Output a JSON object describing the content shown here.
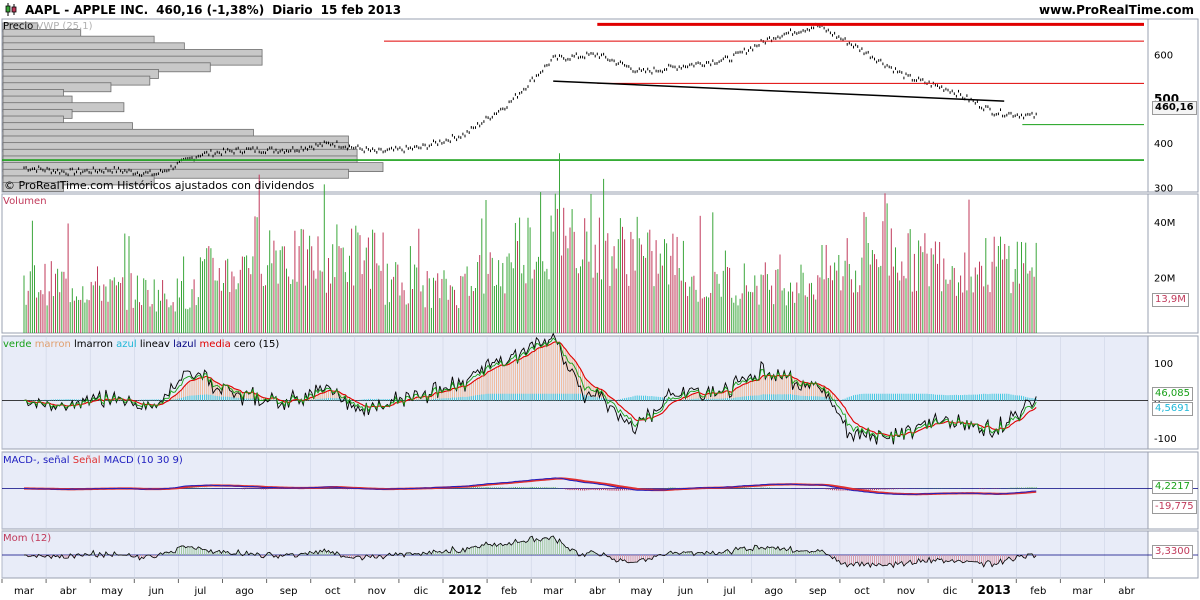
{
  "header": {
    "symbol": "AAPL - APPLE INC.",
    "price_change": "460,16 (-1,38%)",
    "period": "Diario",
    "date": "15 feb 2013",
    "site": "www.ProRealTime.com"
  },
  "colors": {
    "bar_up": "#3aa63a",
    "bar_down": "#c0395a",
    "panel_bg": "#e8ecf8",
    "grid": "#c8cfe2",
    "red_line": "#e00000",
    "green_line": "#18a018",
    "macd": "#2020c0",
    "signal": "#e03030"
  },
  "price_panel": {
    "label": "Precio",
    "vwp_label": "VWP (25,1)",
    "watermark": "© ProRealTime.com  Históricos ajustados con dividendos",
    "y_ticks": [
      "600",
      "500",
      "400",
      "300"
    ],
    "last_tag": "460,16"
  },
  "volume_panel": {
    "label": "Volumen",
    "y_ticks": [
      "40M",
      "20M"
    ],
    "last_tag": "13,9M"
  },
  "moving_avg_panel": {
    "legend": [
      {
        "text": "verde",
        "color": "#18a018"
      },
      {
        "text": "marron",
        "color": "#e0a070"
      },
      {
        "text": "lmarron",
        "color": "#000000"
      },
      {
        "text": "azul",
        "color": "#20b8d8"
      },
      {
        "text": "lineav",
        "color": "#000000"
      },
      {
        "text": "lazul",
        "color": "#000080"
      },
      {
        "text": "media",
        "color": "#e00000"
      },
      {
        "text": "cero (15)",
        "color": "#000000"
      }
    ],
    "y_ticks": [
      "100",
      "0",
      "-100"
    ],
    "tag_green": "46,085",
    "tag_blue": "4,5691"
  },
  "macd_panel": {
    "legend": [
      {
        "text": "MACD-, señal",
        "color": "#2020c0"
      },
      {
        "text": "Señal",
        "color": "#e03030"
      },
      {
        "text": "MACD (10 30 9)",
        "color": "#2020c0"
      }
    ],
    "tag_green": "4,2217",
    "tag_red": "-19,775"
  },
  "mom_panel": {
    "label": "Mom (12)",
    "last_tag": "3,3300"
  },
  "x_axis": {
    "labels": [
      "mar",
      "abr",
      "may",
      "jun",
      "jul",
      "ago",
      "sep",
      "oct",
      "nov",
      "dic",
      "2012",
      "feb",
      "mar",
      "abr",
      "may",
      "jun",
      "jul",
      "ago",
      "sep",
      "oct",
      "nov",
      "dic",
      "2013",
      "feb",
      "mar",
      "abr"
    ]
  },
  "chart_data": {
    "type": "line",
    "title": "AAPL - APPLE INC.",
    "period": "Diario",
    "x_months": [
      "2011-03",
      "2011-04",
      "2011-05",
      "2011-06",
      "2011-07",
      "2011-08",
      "2011-09",
      "2011-10",
      "2011-11",
      "2011-12",
      "2012-01",
      "2012-02",
      "2012-03",
      "2012-04",
      "2012-05",
      "2012-06",
      "2012-07",
      "2012-08",
      "2012-09",
      "2012-10",
      "2012-11",
      "2012-12",
      "2013-01",
      "2013-02"
    ],
    "close_approx": [
      345,
      335,
      340,
      330,
      375,
      385,
      385,
      400,
      380,
      390,
      420,
      490,
      590,
      600,
      560,
      575,
      590,
      640,
      665,
      610,
      550,
      520,
      470,
      460
    ],
    "volume_approx_M": [
      18,
      17,
      15,
      14,
      22,
      30,
      26,
      28,
      18,
      16,
      22,
      32,
      36,
      30,
      26,
      18,
      18,
      18,
      22,
      30,
      26,
      24,
      26,
      17
    ],
    "lines": [
      {
        "color": "red",
        "level": 668,
        "from": "2012-04",
        "to": "2013-02"
      },
      {
        "color": "red",
        "level": 630,
        "from": "2011-11",
        "to": "2013-02"
      },
      {
        "color": "red",
        "level": 535,
        "from": "2012-04",
        "to": "2013-02"
      },
      {
        "color": "green",
        "level": 442,
        "from": "2013-02",
        "to": "2013-02"
      },
      {
        "color": "green",
        "level": 362,
        "from": "2011-03",
        "to": "2013-02"
      },
      {
        "color": "black",
        "from_value": 540,
        "to_value": 495,
        "from": "2012-03",
        "to": "2013-01"
      }
    ],
    "vwp_profile": [
      {
        "price": 660,
        "volume": 8
      },
      {
        "price": 645,
        "volume": 18
      },
      {
        "price": 630,
        "volume": 35
      },
      {
        "price": 615,
        "volume": 42
      },
      {
        "price": 600,
        "volume": 60
      },
      {
        "price": 585,
        "volume": 60
      },
      {
        "price": 570,
        "volume": 48
      },
      {
        "price": 555,
        "volume": 36
      },
      {
        "price": 540,
        "volume": 34
      },
      {
        "price": 525,
        "volume": 25
      },
      {
        "price": 510,
        "volume": 14
      },
      {
        "price": 495,
        "volume": 16
      },
      {
        "price": 480,
        "volume": 28
      },
      {
        "price": 465,
        "volume": 16
      },
      {
        "price": 450,
        "volume": 14
      },
      {
        "price": 435,
        "volume": 30
      },
      {
        "price": 420,
        "volume": 58
      },
      {
        "price": 405,
        "volume": 80
      },
      {
        "price": 390,
        "volume": 80
      },
      {
        "price": 375,
        "volume": 82
      },
      {
        "price": 360,
        "volume": 82
      },
      {
        "price": 345,
        "volume": 88
      },
      {
        "price": 330,
        "volume": 80
      },
      {
        "price": 315,
        "volume": 35
      },
      {
        "price": 300,
        "volume": 14
      }
    ]
  }
}
